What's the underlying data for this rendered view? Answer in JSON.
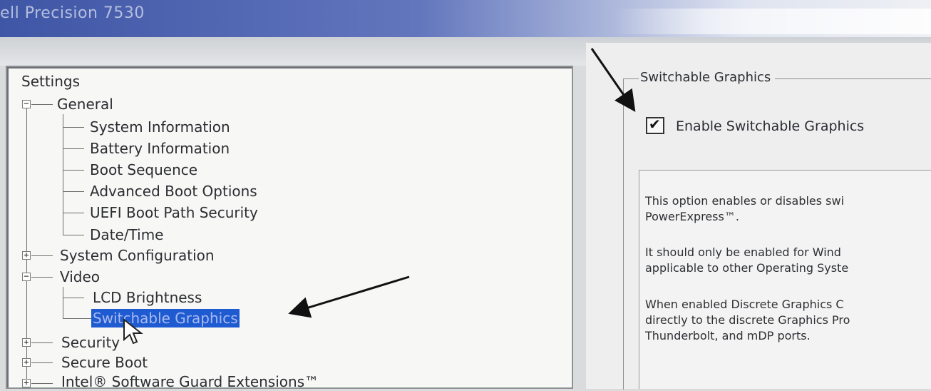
{
  "window": {
    "title": "ell Precision 7530"
  },
  "tree": {
    "root_label": "Settings",
    "items": [
      {
        "label": "General",
        "expander": "−"
      },
      {
        "label": "System Information"
      },
      {
        "label": "Battery Information"
      },
      {
        "label": "Boot Sequence"
      },
      {
        "label": "Advanced Boot Options"
      },
      {
        "label": "UEFI Boot Path Security"
      },
      {
        "label": "Date/Time"
      },
      {
        "label": "System Configuration",
        "expander": "+"
      },
      {
        "label": "Video",
        "expander": "−"
      },
      {
        "label": "LCD Brightness"
      },
      {
        "label": "Switchable Graphics",
        "selected": true
      },
      {
        "label": "Security",
        "expander": "+"
      },
      {
        "label": "Secure Boot",
        "expander": "+"
      },
      {
        "label": "Intel® Software Guard Extensions™",
        "expander": "+"
      }
    ]
  },
  "details": {
    "group_title": "Switchable Graphics",
    "checkbox": {
      "label": "Enable Switchable Graphics",
      "checked": true,
      "mark": "✔"
    },
    "description": [
      "This option enables or disables swi\nPowerExpress™.",
      "It should only be enabled for Wind\napplicable to other Operating Syste",
      "When enabled Discrete Graphics C\ndirectly to the discrete Graphics Pro\nThunderbolt, and mDP ports."
    ]
  },
  "colors": {
    "selection_bg": "#1f5bd0",
    "selection_text": "#a9b9f2",
    "title_bar": "#3f56a6"
  }
}
